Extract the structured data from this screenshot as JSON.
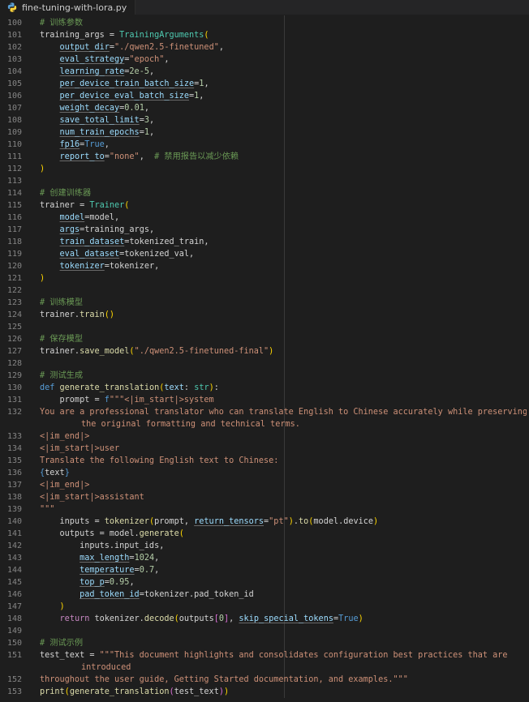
{
  "tab": {
    "title": "fine-tuning-with-lora.py",
    "icon": "python-file-icon"
  },
  "colors": {
    "background": "#1e1e1e",
    "line_number": "#858585",
    "keyword": "#569cd6",
    "control": "#c586c0",
    "function": "#dcdcaa",
    "string": "#ce9178",
    "number": "#b5cea8",
    "comment": "#6a9955",
    "parameter": "#9cdcfe",
    "type": "#4ec9b0",
    "bracket": "#ffd700"
  },
  "lines": [
    {
      "n": "100",
      "tokens": [
        [
          "cm",
          "# 训练参数"
        ]
      ]
    },
    {
      "n": "101",
      "tokens": [
        [
          "txt",
          "training_args = "
        ],
        [
          "ty",
          "TrainingArguments"
        ],
        [
          "brk",
          "("
        ]
      ]
    },
    {
      "n": "102",
      "tokens": [
        [
          "txt",
          "    "
        ],
        [
          "kwarg",
          "output_dir"
        ],
        [
          "txt",
          "="
        ],
        [
          "str",
          "\"./qwen2.5-finetuned\""
        ],
        [
          "txt",
          ","
        ]
      ]
    },
    {
      "n": "103",
      "tokens": [
        [
          "txt",
          "    "
        ],
        [
          "kwarg",
          "eval_strategy"
        ],
        [
          "txt",
          "="
        ],
        [
          "str",
          "\"epoch\""
        ],
        [
          "txt",
          ","
        ]
      ]
    },
    {
      "n": "104",
      "tokens": [
        [
          "txt",
          "    "
        ],
        [
          "kwarg",
          "learning_rate"
        ],
        [
          "txt",
          "="
        ],
        [
          "num",
          "2e-5"
        ],
        [
          "txt",
          ","
        ]
      ]
    },
    {
      "n": "105",
      "tokens": [
        [
          "txt",
          "    "
        ],
        [
          "kwarg",
          "per_device_train_batch_size"
        ],
        [
          "txt",
          "="
        ],
        [
          "num",
          "1"
        ],
        [
          "txt",
          ","
        ]
      ]
    },
    {
      "n": "106",
      "tokens": [
        [
          "txt",
          "    "
        ],
        [
          "kwarg",
          "per_device_eval_batch_size"
        ],
        [
          "txt",
          "="
        ],
        [
          "num",
          "1"
        ],
        [
          "txt",
          ","
        ]
      ]
    },
    {
      "n": "107",
      "tokens": [
        [
          "txt",
          "    "
        ],
        [
          "kwarg",
          "weight_decay"
        ],
        [
          "txt",
          "="
        ],
        [
          "num",
          "0.01"
        ],
        [
          "txt",
          ","
        ]
      ]
    },
    {
      "n": "108",
      "tokens": [
        [
          "txt",
          "    "
        ],
        [
          "kwarg",
          "save_total_limit"
        ],
        [
          "txt",
          "="
        ],
        [
          "num",
          "3"
        ],
        [
          "txt",
          ","
        ]
      ]
    },
    {
      "n": "109",
      "tokens": [
        [
          "txt",
          "    "
        ],
        [
          "kwarg",
          "num_train_epochs"
        ],
        [
          "txt",
          "="
        ],
        [
          "num",
          "1"
        ],
        [
          "txt",
          ","
        ]
      ]
    },
    {
      "n": "110",
      "tokens": [
        [
          "txt",
          "    "
        ],
        [
          "kwarg",
          "fp16"
        ],
        [
          "txt",
          "="
        ],
        [
          "kw",
          "True"
        ],
        [
          "txt",
          ","
        ]
      ]
    },
    {
      "n": "111",
      "tokens": [
        [
          "txt",
          "    "
        ],
        [
          "kwarg",
          "report_to"
        ],
        [
          "txt",
          "="
        ],
        [
          "str",
          "\"none\""
        ],
        [
          "txt",
          ",  "
        ],
        [
          "cm",
          "# 禁用报告以减少依赖"
        ]
      ]
    },
    {
      "n": "112",
      "tokens": [
        [
          "brk",
          ")"
        ]
      ]
    },
    {
      "n": "113",
      "tokens": []
    },
    {
      "n": "114",
      "tokens": [
        [
          "cm",
          "# 创建训练器"
        ]
      ]
    },
    {
      "n": "115",
      "tokens": [
        [
          "txt",
          "trainer = "
        ],
        [
          "ty",
          "Trainer"
        ],
        [
          "brk",
          "("
        ]
      ]
    },
    {
      "n": "116",
      "tokens": [
        [
          "txt",
          "    "
        ],
        [
          "kwarg",
          "model"
        ],
        [
          "txt",
          "=model,"
        ]
      ]
    },
    {
      "n": "117",
      "tokens": [
        [
          "txt",
          "    "
        ],
        [
          "kwarg",
          "args"
        ],
        [
          "txt",
          "=training_args,"
        ]
      ]
    },
    {
      "n": "118",
      "tokens": [
        [
          "txt",
          "    "
        ],
        [
          "kwarg",
          "train_dataset"
        ],
        [
          "txt",
          "=tokenized_train,"
        ]
      ]
    },
    {
      "n": "119",
      "tokens": [
        [
          "txt",
          "    "
        ],
        [
          "kwarg",
          "eval_dataset"
        ],
        [
          "txt",
          "=tokenized_val,"
        ]
      ]
    },
    {
      "n": "120",
      "tokens": [
        [
          "txt",
          "    "
        ],
        [
          "kwarg",
          "tokenizer"
        ],
        [
          "txt",
          "=tokenizer,"
        ]
      ]
    },
    {
      "n": "121",
      "tokens": [
        [
          "brk",
          ")"
        ]
      ]
    },
    {
      "n": "122",
      "tokens": []
    },
    {
      "n": "123",
      "tokens": [
        [
          "cm",
          "# 训练模型"
        ]
      ]
    },
    {
      "n": "124",
      "tokens": [
        [
          "txt",
          "trainer."
        ],
        [
          "fn",
          "train"
        ],
        [
          "brk",
          "()"
        ]
      ]
    },
    {
      "n": "125",
      "tokens": []
    },
    {
      "n": "126",
      "tokens": [
        [
          "cm",
          "# 保存模型"
        ]
      ]
    },
    {
      "n": "127",
      "tokens": [
        [
          "txt",
          "trainer."
        ],
        [
          "fn",
          "save_model"
        ],
        [
          "brk",
          "("
        ],
        [
          "str",
          "\"./qwen2.5-finetuned-final\""
        ],
        [
          "brk",
          ")"
        ]
      ]
    },
    {
      "n": "128",
      "tokens": []
    },
    {
      "n": "129",
      "tokens": [
        [
          "cm",
          "# 测试生成"
        ]
      ]
    },
    {
      "n": "130",
      "tokens": [
        [
          "kw",
          "def "
        ],
        [
          "fn",
          "generate_translation"
        ],
        [
          "brk",
          "("
        ],
        [
          "prm",
          "text"
        ],
        [
          "txt",
          ": "
        ],
        [
          "ty",
          "str"
        ],
        [
          "brk",
          ")"
        ],
        [
          "txt",
          ":"
        ]
      ]
    },
    {
      "n": "131",
      "tokens": [
        [
          "txt",
          "    prompt = "
        ],
        [
          "kw",
          "f"
        ],
        [
          "str",
          "\"\"\"<|im_start|>system"
        ]
      ]
    },
    {
      "n": "132",
      "tokens": [
        [
          "str",
          "You are a professional translator who can translate English to Chinese accurately while preserving"
        ]
      ]
    },
    {
      "n": "",
      "cont": true,
      "tokens": [
        [
          "str",
          "the original formatting and technical terms."
        ]
      ]
    },
    {
      "n": "133",
      "tokens": [
        [
          "str",
          "<|im_end|>"
        ]
      ]
    },
    {
      "n": "134",
      "tokens": [
        [
          "str",
          "<|im_start|>user"
        ]
      ]
    },
    {
      "n": "135",
      "tokens": [
        [
          "str",
          "Translate the following English text to Chinese:"
        ]
      ]
    },
    {
      "n": "136",
      "tokens": [
        [
          "ph",
          "{"
        ],
        [
          "txt",
          "text"
        ],
        [
          "ph",
          "}"
        ]
      ]
    },
    {
      "n": "137",
      "tokens": [
        [
          "str",
          "<|im_end|>"
        ]
      ]
    },
    {
      "n": "138",
      "tokens": [
        [
          "str",
          "<|im_start|>assistant"
        ]
      ]
    },
    {
      "n": "139",
      "tokens": [
        [
          "str",
          "\"\"\""
        ]
      ]
    },
    {
      "n": "140",
      "tokens": [
        [
          "txt",
          "    inputs = "
        ],
        [
          "fn",
          "tokenizer"
        ],
        [
          "brk",
          "("
        ],
        [
          "txt",
          "prompt, "
        ],
        [
          "kwarg",
          "return_tensors"
        ],
        [
          "txt",
          "="
        ],
        [
          "str",
          "\"pt\""
        ],
        [
          "brk",
          ")"
        ],
        [
          "txt",
          "."
        ],
        [
          "fn",
          "to"
        ],
        [
          "brk",
          "("
        ],
        [
          "txt",
          "model.device"
        ],
        [
          "brk",
          ")"
        ]
      ]
    },
    {
      "n": "141",
      "tokens": [
        [
          "txt",
          "    outputs = model."
        ],
        [
          "fn",
          "generate"
        ],
        [
          "brk",
          "("
        ]
      ]
    },
    {
      "n": "142",
      "tokens": [
        [
          "txt",
          "        inputs.input_ids,"
        ]
      ]
    },
    {
      "n": "143",
      "tokens": [
        [
          "txt",
          "        "
        ],
        [
          "kwarg",
          "max_length"
        ],
        [
          "txt",
          "="
        ],
        [
          "num",
          "1024"
        ],
        [
          "txt",
          ","
        ]
      ]
    },
    {
      "n": "144",
      "tokens": [
        [
          "txt",
          "        "
        ],
        [
          "kwarg",
          "temperature"
        ],
        [
          "txt",
          "="
        ],
        [
          "num",
          "0.7"
        ],
        [
          "txt",
          ","
        ]
      ]
    },
    {
      "n": "145",
      "tokens": [
        [
          "txt",
          "        "
        ],
        [
          "kwarg",
          "top_p"
        ],
        [
          "txt",
          "="
        ],
        [
          "num",
          "0.95"
        ],
        [
          "txt",
          ","
        ]
      ]
    },
    {
      "n": "146",
      "tokens": [
        [
          "txt",
          "        "
        ],
        [
          "kwarg",
          "pad_token_id"
        ],
        [
          "txt",
          "=tokenizer.pad_token_id"
        ]
      ]
    },
    {
      "n": "147",
      "tokens": [
        [
          "txt",
          "    "
        ],
        [
          "brk",
          ")"
        ]
      ]
    },
    {
      "n": "148",
      "tokens": [
        [
          "txt",
          "    "
        ],
        [
          "ctl",
          "return "
        ],
        [
          "txt",
          "tokenizer."
        ],
        [
          "fn",
          "decode"
        ],
        [
          "brk",
          "("
        ],
        [
          "txt",
          "outputs"
        ],
        [
          "brk2",
          "["
        ],
        [
          "num",
          "0"
        ],
        [
          "brk2",
          "]"
        ],
        [
          "txt",
          ", "
        ],
        [
          "kwarg",
          "skip_special_tokens"
        ],
        [
          "txt",
          "="
        ],
        [
          "kw",
          "True"
        ],
        [
          "brk",
          ")"
        ]
      ]
    },
    {
      "n": "149",
      "tokens": []
    },
    {
      "n": "150",
      "tokens": [
        [
          "cm",
          "# 测试示例"
        ]
      ]
    },
    {
      "n": "151",
      "tokens": [
        [
          "txt",
          "test_text = "
        ],
        [
          "str",
          "\"\"\"This document highlights and consolidates configuration best practices that are"
        ]
      ]
    },
    {
      "n": "",
      "cont": true,
      "tokens": [
        [
          "str",
          "introduced"
        ]
      ]
    },
    {
      "n": "152",
      "tokens": [
        [
          "str",
          "throughout the user guide, Getting Started documentation, and examples.\"\"\""
        ]
      ]
    },
    {
      "n": "153",
      "tokens": [
        [
          "fn",
          "print"
        ],
        [
          "brk",
          "("
        ],
        [
          "fn",
          "generate_translation"
        ],
        [
          "brk2",
          "("
        ],
        [
          "txt",
          "test_text"
        ],
        [
          "brk2",
          ")"
        ],
        [
          "brk",
          ")"
        ]
      ]
    }
  ]
}
